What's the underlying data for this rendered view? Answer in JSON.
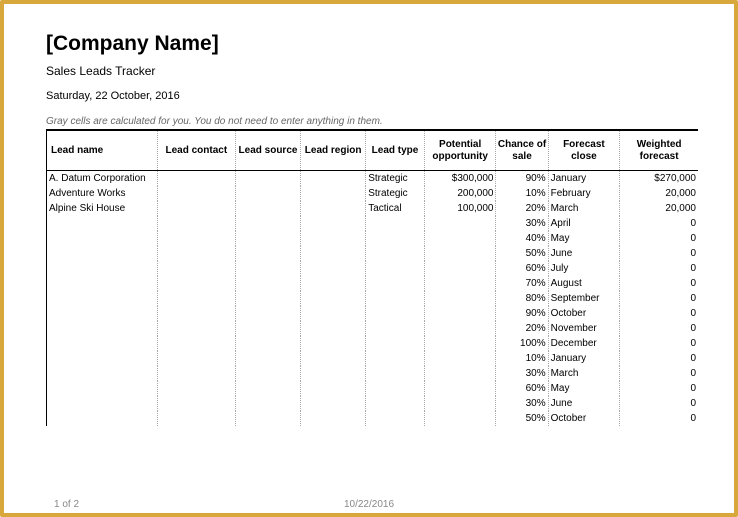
{
  "header": {
    "company": "[Company Name]",
    "subtitle": "Sales Leads Tracker",
    "date": "Saturday, 22 October, 2016",
    "hint": "Gray cells are calculated for you. You do not need to enter anything in them."
  },
  "columns": {
    "lead_name": "Lead   name",
    "lead_contact": "Lead   contact",
    "lead_source": "Lead   source",
    "lead_region": "Lead   region",
    "lead_type": "Lead   type",
    "potential": "Potential opportunity",
    "chance": "Chance of sale",
    "forecast": "Forecast close",
    "weighted": "Weighted forecast"
  },
  "rows": [
    {
      "name": "A. Datum Corporation",
      "contact": "",
      "source": "",
      "region": "",
      "type": "Strategic",
      "potential": "$300,000",
      "chance": "90%",
      "forecast": "January",
      "weighted": "$270,000"
    },
    {
      "name": "Adventure Works",
      "contact": "",
      "source": "",
      "region": "",
      "type": "Strategic",
      "potential": "200,000",
      "chance": "10%",
      "forecast": "February",
      "weighted": "20,000"
    },
    {
      "name": "Alpine Ski House",
      "contact": "",
      "source": "",
      "region": "",
      "type": "Tactical",
      "potential": "100,000",
      "chance": "20%",
      "forecast": "March",
      "weighted": "20,000"
    },
    {
      "name": "",
      "contact": "",
      "source": "",
      "region": "",
      "type": "",
      "potential": "",
      "chance": "30%",
      "forecast": "April",
      "weighted": "0"
    },
    {
      "name": "",
      "contact": "",
      "source": "",
      "region": "",
      "type": "",
      "potential": "",
      "chance": "40%",
      "forecast": "May",
      "weighted": "0"
    },
    {
      "name": "",
      "contact": "",
      "source": "",
      "region": "",
      "type": "",
      "potential": "",
      "chance": "50%",
      "forecast": "June",
      "weighted": "0"
    },
    {
      "name": "",
      "contact": "",
      "source": "",
      "region": "",
      "type": "",
      "potential": "",
      "chance": "60%",
      "forecast": "July",
      "weighted": "0"
    },
    {
      "name": "",
      "contact": "",
      "source": "",
      "region": "",
      "type": "",
      "potential": "",
      "chance": "70%",
      "forecast": "August",
      "weighted": "0"
    },
    {
      "name": "",
      "contact": "",
      "source": "",
      "region": "",
      "type": "",
      "potential": "",
      "chance": "80%",
      "forecast": "September",
      "weighted": "0"
    },
    {
      "name": "",
      "contact": "",
      "source": "",
      "region": "",
      "type": "",
      "potential": "",
      "chance": "90%",
      "forecast": "October",
      "weighted": "0"
    },
    {
      "name": "",
      "contact": "",
      "source": "",
      "region": "",
      "type": "",
      "potential": "",
      "chance": "20%",
      "forecast": "November",
      "weighted": "0"
    },
    {
      "name": "",
      "contact": "",
      "source": "",
      "region": "",
      "type": "",
      "potential": "",
      "chance": "100%",
      "forecast": "December",
      "weighted": "0"
    },
    {
      "name": "",
      "contact": "",
      "source": "",
      "region": "",
      "type": "",
      "potential": "",
      "chance": "10%",
      "forecast": "January",
      "weighted": "0"
    },
    {
      "name": "",
      "contact": "",
      "source": "",
      "region": "",
      "type": "",
      "potential": "",
      "chance": "30%",
      "forecast": "March",
      "weighted": "0"
    },
    {
      "name": "",
      "contact": "",
      "source": "",
      "region": "",
      "type": "",
      "potential": "",
      "chance": "60%",
      "forecast": "May",
      "weighted": "0"
    },
    {
      "name": "",
      "contact": "",
      "source": "",
      "region": "",
      "type": "",
      "potential": "",
      "chance": "30%",
      "forecast": "June",
      "weighted": "0"
    },
    {
      "name": "",
      "contact": "",
      "source": "",
      "region": "",
      "type": "",
      "potential": "",
      "chance": "50%",
      "forecast": "October",
      "weighted": "0"
    }
  ],
  "footer": {
    "pagecount": "1 of 2",
    "date": "10/22/2016"
  }
}
